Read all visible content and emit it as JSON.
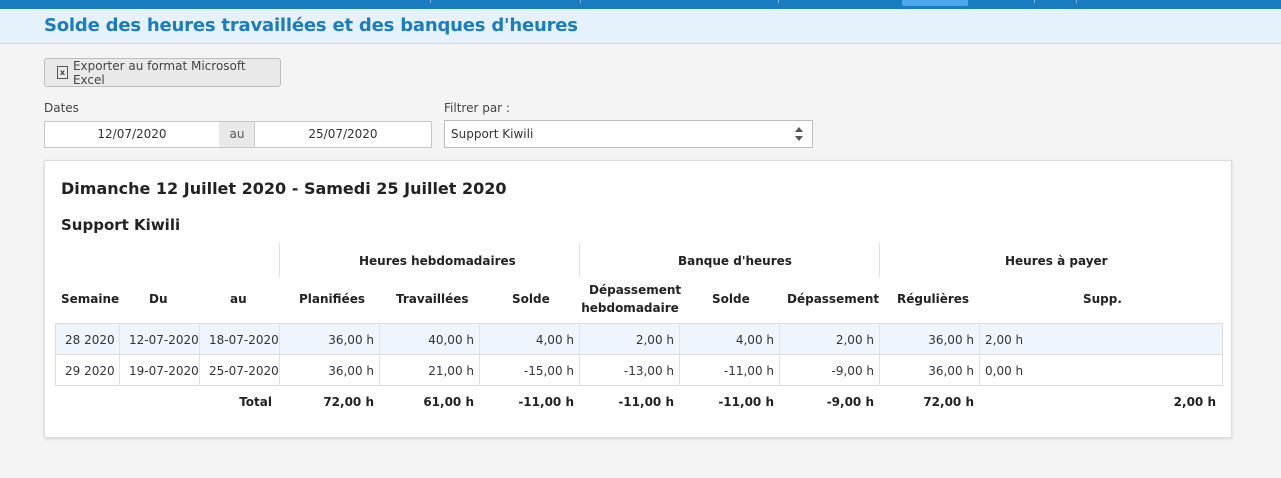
{
  "page": {
    "title": "Solde des heures travaillées et des banques d'heures",
    "export_label": "Exporter au format Microsoft Excel",
    "export_icon": "excel-file-icon"
  },
  "filters": {
    "dates_label": "Dates",
    "date_from": "12/07/2020",
    "date_sep": "au",
    "date_to": "25/07/2020",
    "filter_label": "Filtrer par :",
    "filter_value": "Support Kiwili"
  },
  "report": {
    "period": "Dimanche 12 Juillet 2020 - Samedi 25 Juillet 2020",
    "group": "Support Kiwili",
    "groups": {
      "hebdo": "Heures hebdomadaires",
      "banque": "Banque d'heures",
      "payer": "Heures à payer"
    },
    "columns": {
      "semaine": "Semaine",
      "du": "Du",
      "au": "au",
      "planifiees": "Planifiées",
      "travaillees": "Travaillées",
      "solde": "Solde",
      "depassement_hebdo_1": "Dépassement",
      "depassement_hebdo_2": "hebdomadaire",
      "banque_solde": "Solde",
      "banque_depassement": "Dépassement",
      "regulieres": "Régulières",
      "supp": "Supp."
    },
    "rows": [
      {
        "semaine": "28 2020",
        "du": "12-07-2020",
        "au": "18-07-2020",
        "planifiees": "36,00 h",
        "travaillees": "40,00 h",
        "solde": "4,00 h",
        "dep_hebdo": "2,00 h",
        "banque_solde": "4,00 h",
        "banque_dep": "2,00 h",
        "regulieres": "36,00 h",
        "supp": "2,00 h"
      },
      {
        "semaine": "29 2020",
        "du": "19-07-2020",
        "au": "25-07-2020",
        "planifiees": "36,00 h",
        "travaillees": "21,00 h",
        "solde": "-15,00 h",
        "dep_hebdo": "-13,00 h",
        "banque_solde": "-11,00 h",
        "banque_dep": "-9,00 h",
        "regulieres": "36,00 h",
        "supp": "0,00 h"
      }
    ],
    "total": {
      "label": "Total",
      "planifiees": "72,00 h",
      "travaillees": "61,00 h",
      "solde": "-11,00 h",
      "dep_hebdo": "-11,00 h",
      "banque_solde": "-11,00 h",
      "banque_dep": "-9,00 h",
      "regulieres": "72,00 h",
      "supp": "2,00 h"
    }
  }
}
